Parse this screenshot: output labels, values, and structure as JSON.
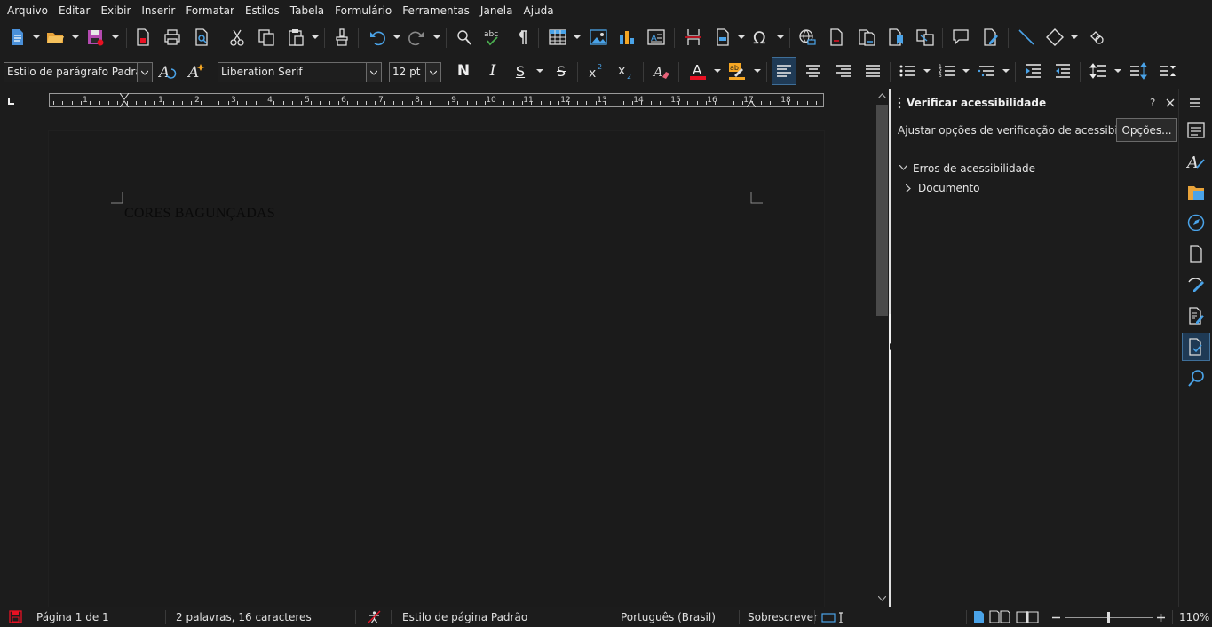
{
  "menu": [
    "Arquivo",
    "Editar",
    "Exibir",
    "Inserir",
    "Formatar",
    "Estilos",
    "Tabela",
    "Formulário",
    "Ferramentas",
    "Janela",
    "Ajuda"
  ],
  "formatting": {
    "paragraph_style": "Estilo de parágrafo Padrão",
    "font_name": "Liberation Serif",
    "font_size": "12 pt",
    "bold_label": "N",
    "italic_label": "I",
    "underline_label": "S",
    "strike_label": "S"
  },
  "ruler": {
    "numbers": [
      "1",
      "1",
      "2",
      "3",
      "4",
      "5",
      "6",
      "7",
      "8",
      "9",
      "10",
      "11",
      "12",
      "13",
      "14",
      "15",
      "16",
      "17",
      "18"
    ]
  },
  "document": {
    "text": "CORES BAGUNÇADAS"
  },
  "sidebar": {
    "title": "Verificar acessibilidade",
    "help": "?",
    "description": "Ajustar opções de verificação de acessibilidade",
    "options_button": "Opções...",
    "tree": {
      "root": "Erros de acessibilidade",
      "child": "Documento"
    }
  },
  "status": {
    "page": "Página 1 de 1",
    "words": "2 palavras, 16 caracteres",
    "page_style": "Estilo de página Padrão",
    "language": "Português (Brasil)",
    "mode": "Sobrescrever",
    "zoom": "110%"
  },
  "colors": {
    "accent": "#4aa3e8",
    "font_color_bar": "#e81123",
    "highlight_bar": "#f5a623"
  }
}
